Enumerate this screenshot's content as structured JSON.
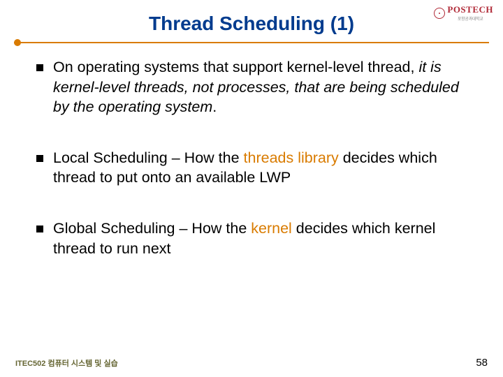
{
  "header": {
    "title": "Thread Scheduling (1)",
    "logo_text": "POSTECH",
    "logo_sub": "포항공과대학교"
  },
  "bullets": [
    {
      "prefix": "On operating systems that support kernel-level thread, ",
      "italic": "it is kernel-level threads, not processes, that are being scheduled by the operating system",
      "suffix": "."
    },
    {
      "lead": "Local Scheduling",
      "mid1": " – How the ",
      "hl": "threads library",
      "mid2": " decides which thread to put onto an available LWP"
    },
    {
      "lead": "Global Scheduling",
      "mid1": " – How the ",
      "hl": "kernel",
      "mid2": " decides which kernel thread to run next"
    }
  ],
  "footer": {
    "left": "ITEC502 컴퓨터 시스템 및 실습",
    "page": "58"
  }
}
